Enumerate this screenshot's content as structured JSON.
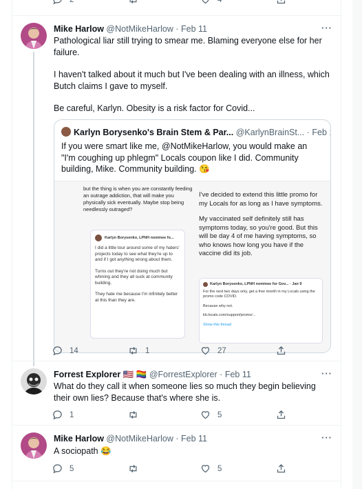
{
  "prev_actions": {
    "reply": "2",
    "retweet": "",
    "like": "4"
  },
  "tweet1": {
    "name": "Mike Harlow",
    "handle": "@NotMikeHarlow",
    "date": "Feb 11",
    "paragraphs": [
      "Pathological liar still trying to smear me. Blaming everyone else for her failure.",
      "I haven't talked about it much but I've been dealing with an illness, which Butch claims I gave to myself.",
      "Be careful, Karlyn. Obesity is a risk factor for Covid..."
    ],
    "quote": {
      "name": "Karlyn Borysenko's Brain Stem & Par...",
      "handle": "@KarlynBrainSt...",
      "date": "Feb 11",
      "text": "If you were smart like me, @NotMikeHarlow, you would make an \"I'm coughing up phlegm\" Locals coupon like I did. Community building, Mike. Community building.",
      "emoji": "😘",
      "media": {
        "left_text": "but the thing is when you are constantly feeding an outrage addiction, that will make you physically sick eventually. Maybe stop being needlessly outraged?",
        "card_name": "Karlyn Borysenko, LPNH nominee fo...",
        "card_paragraphs": [
          "I did a little tour around some of my haters' projects today to see what they're up to and if I got anything wrong about them.",
          "Turns out they're not doing much but whining and they all suck at community building.",
          "They hate me because I'm infinitely better at this than they are."
        ],
        "right_paragraphs": [
          "I've decided to extend this little promo for my Locals for as long as I have symptoms.",
          "My vaccinated self definitely still has symptoms today, so you're good. But this will be day 4 of me having symptoms, so who knows how long you have if the vaccine did its job."
        ],
        "sub_name": "Karlyn Borysenko, LPNH nominee for Gov...",
        "sub_date": "Jan 9",
        "sub_paragraphs": [
          "For the next two days only, get a free month in my Locals using the promo code COVID.",
          "Because why not.",
          "kb.locals.com/support/promo/..."
        ],
        "sub_link": "Show this thread"
      }
    },
    "actions": {
      "reply": "14",
      "retweet": "1",
      "like": "27"
    }
  },
  "tweet2": {
    "name": "Forrest Explorer",
    "flags": "🇺🇸 🏳️‍🌈",
    "handle": "@ForrestExplorer",
    "date": "Feb 11",
    "text": "What do they call it when someone lies so much they begin believing their own lies? Because that's where she is.",
    "actions": {
      "reply": "1",
      "retweet": "",
      "like": "5"
    }
  },
  "tweet3": {
    "name": "Mike Harlow",
    "handle": "@NotMikeHarlow",
    "date": "Feb 11",
    "text": "A sociopath",
    "emoji": "😂",
    "actions": {
      "reply": "5",
      "retweet": "",
      "like": "5"
    }
  },
  "more_label": "···"
}
